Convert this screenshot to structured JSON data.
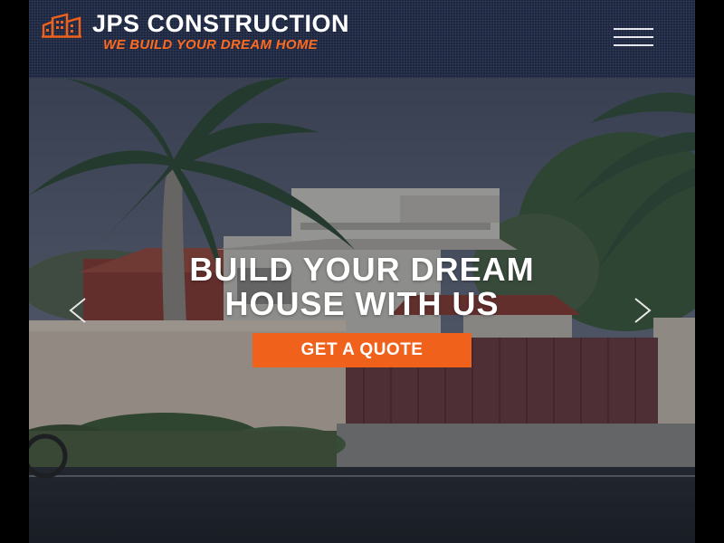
{
  "header": {
    "brand_name": "JPS CONSTRUCTION",
    "tagline": "WE BUILD YOUR DREAM HOME",
    "logo_icon": "building-icon",
    "menu_icon": "hamburger-menu-icon"
  },
  "hero": {
    "title_line1": "BUILD YOUR DREAM",
    "title_line2": "HOUSE WITH US",
    "cta_label": "GET A QUOTE",
    "prev_icon": "chevron-left-icon",
    "next_icon": "chevron-right-icon"
  },
  "colors": {
    "header_bg": "#1d2640",
    "accent": "#f0621c",
    "tagline": "#ff6a1f",
    "text": "#ffffff"
  }
}
